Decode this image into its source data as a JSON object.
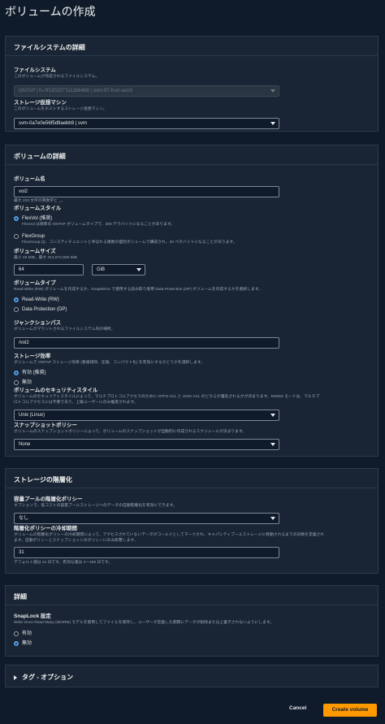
{
  "page": {
    "title": "ボリュームの作成"
  },
  "fs_section": {
    "title": "ファイルシステムの詳細",
    "filesystem": {
      "label": "ファイルシステム",
      "desc": "このボリュームが作成されるファイルシステム。",
      "value": "ONTAP | fs-0f1302377a12b6488 | ooni-97-fsxn-aon3"
    },
    "svm": {
      "label": "ストレージ仮想マシン",
      "desc": "このボリュームをホストするストレージ仮想マシン。",
      "value": "svm-0a7e0e56f5d9aebb9 | svm"
    }
  },
  "vol_section": {
    "title": "ボリュームの詳細",
    "name": {
      "label": "ボリューム名",
      "value": "vol2",
      "hint": "最大 203 文字の英数字と _。"
    },
    "style": {
      "label": "ボリュームスタイル",
      "options": [
        {
          "label": "FlexVol (推奨)",
          "desc": "FlexVol は標準の ONTAP ボリュームタイプで、300 テラバイトになることがあります。",
          "checked": true
        },
        {
          "label": "FlexGroup",
          "desc": "FlexGroup は、コンスティチュエントと呼ばれる複数の個別ボリュームで構成され、20 ペタバイトになることがあります。",
          "checked": false
        }
      ]
    },
    "size": {
      "label": "ボリュームサイズ",
      "desc": "最小 20 MiB、最大 314,572,800 MiB",
      "value": "64",
      "unit": "GiB"
    },
    "type": {
      "label": "ボリュームタイプ",
      "desc": "Read-Write (RW) ボリュームを作成するか、SnapMirror で使用する読み取り専用 Data Protection (DP) ボリュームを作成するかを選択します。",
      "options": [
        {
          "label": "Read-Write (RW)",
          "checked": true
        },
        {
          "label": "Data Protection (DP)",
          "checked": false
        }
      ]
    },
    "junction": {
      "label": "ジャンクションパス",
      "desc": "ボリュームがマウントされるファイルシステム内の場所。",
      "value": "/vol2"
    },
    "efficiency": {
      "label": "ストレージ効率",
      "desc": "ボリュームで ONTAP ストレージ効率 (重複排除、圧縮、コンパクト化) を有効にするかどうかを選択します。",
      "options": [
        {
          "label": "有効 (推奨)",
          "checked": true
        },
        {
          "label": "無効",
          "checked": false
        }
      ]
    },
    "security": {
      "label": "ボリュームのセキュリティスタイル",
      "desc1": "ボリュームのセキュリティスタイルによって、マルチプロトコルアクセスのために NTFS ACL と UNIX ACL のどちらが優先されるかが決まります。MIXED モードは、マルチプ",
      "desc2": "ロトコルアクセスには不要であり、上級ユーザーにのみ推奨されます。",
      "value": "Unix (Linux)"
    },
    "snapshot": {
      "label": "スナップショットポリシー",
      "desc": "ボリュームのスナップショットポリシーによって、ボリュームのスナップショットが自動的に作成されるスケジュールが決まります。",
      "value": "None"
    }
  },
  "tier_section": {
    "title": "ストレージの階層化",
    "policy": {
      "label": "容量プールの階層化ポリシー",
      "desc": "オプションで、低コストの容量プールストレージへのデータの自動階層化を有効にできます。",
      "value": "なし"
    },
    "cooling": {
      "label": "階層化ポリシーの冷却期間",
      "desc1": "ボリュームの階層化ポリシーの冷却期間によって、アクセスされていないデータがコールドとしてマークされ、キャパシティプールストレージに移動されるまでの日数を定義され",
      "desc2": "ます。自動ポリシーとスナップショットのポリシーにのみ影響します。",
      "value": "31",
      "hint": "デフォルト値は 31 日です。有効な値は 2～183 日です。"
    }
  },
  "detail_section": {
    "title": "詳細",
    "snaplock": {
      "label": "SnapLock 設定",
      "desc": "Write Once Read Many (WORM) モデルを使用してファイルを保存し、ユーザーが定義した期間にデータが削除または上書きされないようにします。",
      "options": [
        {
          "label": "有効",
          "checked": false
        },
        {
          "label": "無効",
          "checked": true
        }
      ]
    }
  },
  "tags_section": {
    "title": "タグ - オプション"
  },
  "footer": {
    "cancel": "Cancel",
    "create": "Create volume"
  },
  "colors": {
    "accent": "#ff9900",
    "radio_selected": "#539fe5",
    "background": "#0f1b2a",
    "panel": "#192534"
  }
}
